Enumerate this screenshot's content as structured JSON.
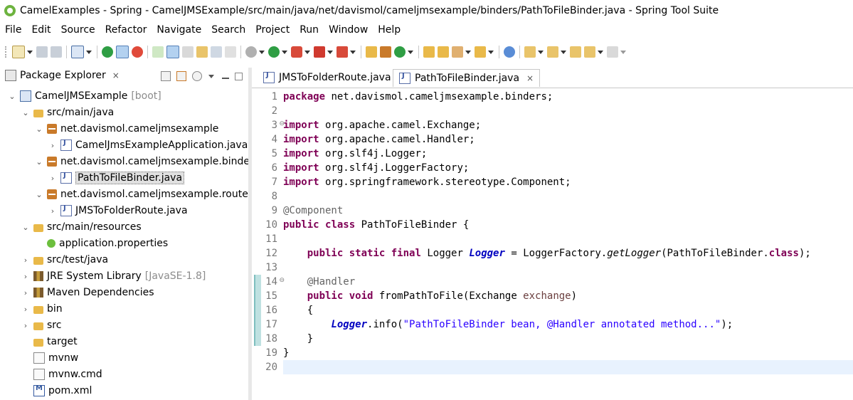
{
  "window": {
    "title": "CamelExamples - Spring - CamelJMSExample/src/main/java/net/davismol/cameljmsexample/binders/PathToFileBinder.java - Spring Tool Suite"
  },
  "menu": [
    "File",
    "Edit",
    "Source",
    "Refactor",
    "Navigate",
    "Search",
    "Project",
    "Run",
    "Window",
    "Help"
  ],
  "package_explorer": {
    "title": "Package Explorer",
    "close": "×",
    "tree": [
      {
        "depth": 0,
        "expanded": true,
        "icon": "project-icon",
        "label": "CamelJMSExample",
        "suffix": "[boot]"
      },
      {
        "depth": 1,
        "expanded": true,
        "icon": "folder-icon",
        "label": "src/main/java",
        "suffix": ""
      },
      {
        "depth": 2,
        "expanded": true,
        "icon": "package-icon",
        "label": "net.davismol.cameljmsexample",
        "suffix": ""
      },
      {
        "depth": 3,
        "expanded": false,
        "icon": "java-file-icon",
        "label": "CamelJmsExampleApplication.java",
        "suffix": ""
      },
      {
        "depth": 2,
        "expanded": true,
        "icon": "package-icon",
        "label": "net.davismol.cameljmsexample.binders",
        "suffix": ""
      },
      {
        "depth": 3,
        "expanded": false,
        "icon": "java-file-icon",
        "label": "PathToFileBinder.java",
        "suffix": "",
        "selected": true
      },
      {
        "depth": 2,
        "expanded": true,
        "icon": "package-icon",
        "label": "net.davismol.cameljmsexample.routes",
        "suffix": ""
      },
      {
        "depth": 3,
        "expanded": false,
        "icon": "java-file-icon",
        "label": "JMSToFolderRoute.java",
        "suffix": ""
      },
      {
        "depth": 1,
        "expanded": true,
        "icon": "folder-icon",
        "label": "src/main/resources",
        "suffix": ""
      },
      {
        "depth": 2,
        "expanded": null,
        "icon": "properties-icon",
        "label": "application.properties",
        "suffix": ""
      },
      {
        "depth": 1,
        "expanded": false,
        "icon": "folder-icon",
        "label": "src/test/java",
        "suffix": ""
      },
      {
        "depth": 1,
        "expanded": false,
        "icon": "library-icon",
        "label": "JRE System Library",
        "suffix": "[JavaSE-1.8]"
      },
      {
        "depth": 1,
        "expanded": false,
        "icon": "library-icon",
        "label": "Maven Dependencies",
        "suffix": ""
      },
      {
        "depth": 1,
        "expanded": false,
        "icon": "folder-icon",
        "label": "bin",
        "suffix": ""
      },
      {
        "depth": 1,
        "expanded": false,
        "icon": "folder-icon",
        "label": "src",
        "suffix": ""
      },
      {
        "depth": 1,
        "expanded": null,
        "icon": "folder-icon",
        "label": "target",
        "suffix": ""
      },
      {
        "depth": 1,
        "expanded": null,
        "icon": "file-icon",
        "label": "mvnw",
        "suffix": ""
      },
      {
        "depth": 1,
        "expanded": null,
        "icon": "file-icon",
        "label": "mvnw.cmd",
        "suffix": ""
      },
      {
        "depth": 1,
        "expanded": null,
        "icon": "xml-file-icon",
        "label": "pom.xml",
        "suffix": ""
      }
    ]
  },
  "editor": {
    "tabs": [
      {
        "label": "JMSToFolderRoute.java",
        "active": false
      },
      {
        "label": "PathToFileBinder.java",
        "active": true,
        "close": "×"
      }
    ],
    "lines": [
      [
        {
          "t": "package",
          "c": "kw"
        },
        {
          "t": " net.davismol.cameljmsexample.binders;",
          "c": ""
        }
      ],
      [],
      [
        {
          "t": "import",
          "c": "kw"
        },
        {
          "t": " org.apache.camel.Exchange;",
          "c": ""
        }
      ],
      [
        {
          "t": "import",
          "c": "kw"
        },
        {
          "t": " org.apache.camel.Handler;",
          "c": ""
        }
      ],
      [
        {
          "t": "import",
          "c": "kw"
        },
        {
          "t": " org.slf4j.Logger;",
          "c": ""
        }
      ],
      [
        {
          "t": "import",
          "c": "kw"
        },
        {
          "t": " org.slf4j.LoggerFactory;",
          "c": ""
        }
      ],
      [
        {
          "t": "import",
          "c": "kw"
        },
        {
          "t": " org.springframework.stereotype.Component;",
          "c": ""
        }
      ],
      [],
      [
        {
          "t": "@Component",
          "c": "ann"
        }
      ],
      [
        {
          "t": "public",
          "c": "kw"
        },
        {
          "t": " ",
          "c": ""
        },
        {
          "t": "class",
          "c": "kw"
        },
        {
          "t": " PathToFileBinder {",
          "c": ""
        }
      ],
      [],
      [
        {
          "t": "    ",
          "c": ""
        },
        {
          "t": "public",
          "c": "kw"
        },
        {
          "t": " ",
          "c": ""
        },
        {
          "t": "static",
          "c": "kw"
        },
        {
          "t": " ",
          "c": ""
        },
        {
          "t": "final",
          "c": "kw"
        },
        {
          "t": " Logger ",
          "c": ""
        },
        {
          "t": "Logger",
          "c": "fld"
        },
        {
          "t": " = LoggerFactory.",
          "c": ""
        },
        {
          "t": "getLogger",
          "c": "stat"
        },
        {
          "t": "(PathToFileBinder.",
          "c": ""
        },
        {
          "t": "class",
          "c": "kw"
        },
        {
          "t": ");",
          "c": ""
        }
      ],
      [],
      [
        {
          "t": "    ",
          "c": ""
        },
        {
          "t": "@Handler",
          "c": "ann"
        }
      ],
      [
        {
          "t": "    ",
          "c": ""
        },
        {
          "t": "public",
          "c": "kw"
        },
        {
          "t": " ",
          "c": ""
        },
        {
          "t": "void",
          "c": "kw"
        },
        {
          "t": " fromPathToFile(Exchange ",
          "c": ""
        },
        {
          "t": "exchange",
          "c": "param"
        },
        {
          "t": ")",
          "c": ""
        }
      ],
      [
        {
          "t": "    {",
          "c": ""
        }
      ],
      [
        {
          "t": "        ",
          "c": ""
        },
        {
          "t": "Logger",
          "c": "fld"
        },
        {
          "t": ".info(",
          "c": ""
        },
        {
          "t": "\"PathToFileBinder bean, @Handler annotated method...\"",
          "c": "str"
        },
        {
          "t": ");",
          "c": ""
        }
      ],
      [
        {
          "t": "    }",
          "c": ""
        }
      ],
      [
        {
          "t": "}",
          "c": ""
        }
      ],
      []
    ],
    "folded_lines": [
      3,
      14
    ],
    "current_line": 20,
    "changed_lines": [
      14,
      15,
      16,
      17,
      18
    ]
  }
}
